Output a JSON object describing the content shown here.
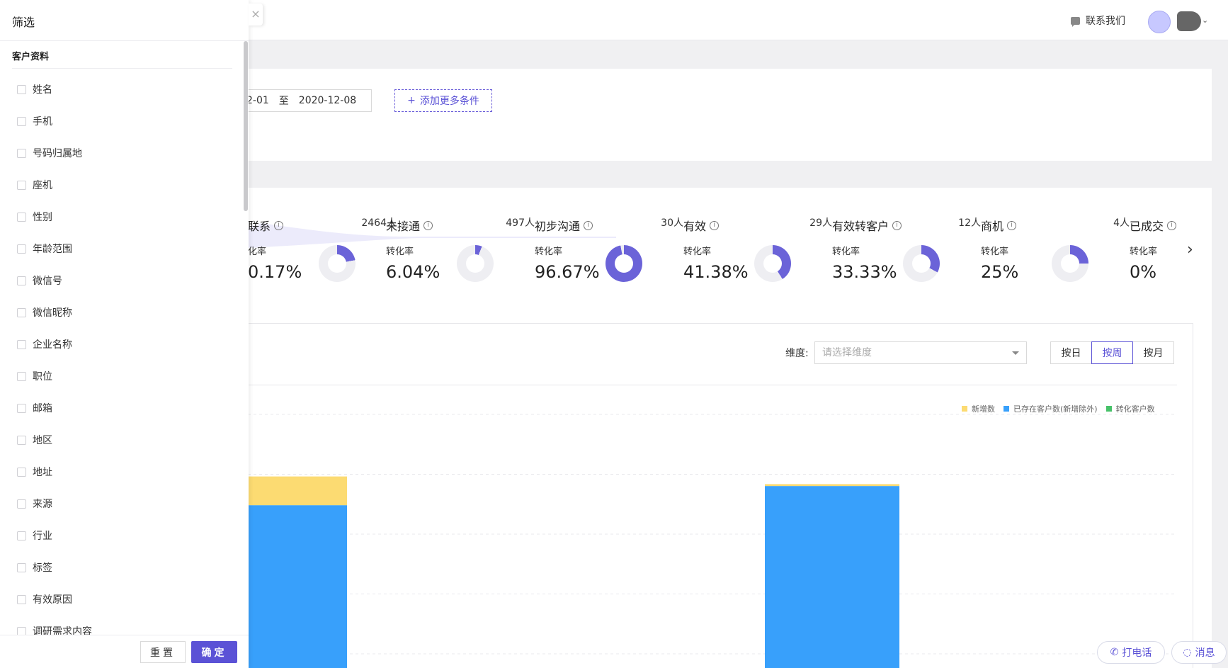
{
  "header": {
    "contact_label": "联系我们",
    "contact_icon": "message-icon",
    "avatar_color": "#c7c8ff"
  },
  "filters": {
    "date_start": "2-01",
    "date_sep": "至",
    "date_end": "2020-12-08",
    "add_condition_label": "添加更多条件",
    "add_condition_icon": "plus-icon"
  },
  "funnel": {
    "stages": [
      {
        "name": "联系",
        "count": "2464人",
        "rate_label": "化率",
        "rate": "0.17%",
        "donut_pct": 22
      },
      {
        "name": "未接通",
        "count": "497人",
        "rate_label": "转化率",
        "rate": "6.04%",
        "donut_pct": 6
      },
      {
        "name": "初步沟通",
        "count": "30人",
        "rate_label": "转化率",
        "rate": "96.67%",
        "donut_pct": 97
      },
      {
        "name": "有效",
        "count": "29人",
        "rate_label": "转化率",
        "rate": "41.38%",
        "donut_pct": 41
      },
      {
        "name": "有效转客户",
        "count": "12人",
        "rate_label": "转化率",
        "rate": "33.33%",
        "donut_pct": 33
      },
      {
        "name": "商机",
        "count": "4人",
        "rate_label": "转化率",
        "rate": "25%",
        "donut_pct": 25
      },
      {
        "name": "已成交",
        "count": "",
        "rate_label": "转化率",
        "rate": "0%",
        "donut_pct": 0
      }
    ],
    "info_glyph": "i",
    "accent": "#6b63d8"
  },
  "chart_controls": {
    "dimension_label": "维度:",
    "dimension_placeholder": "请选择维度",
    "period_buttons": [
      "按日",
      "按周",
      "按月"
    ],
    "active_period": "按周"
  },
  "chart_data": {
    "type": "bar",
    "stacked": true,
    "series": [
      {
        "name": "新增数",
        "color": "#fcdb72",
        "values": [
          3,
          0.2
        ]
      },
      {
        "name": "已存在客户数(新增除外)",
        "color": "#38a0fb",
        "values": [
          17,
          19
        ]
      },
      {
        "name": "转化客户数",
        "color": "#47c269",
        "values": [
          0,
          0
        ]
      }
    ],
    "grid": true,
    "legend_position": "top-right"
  },
  "drawer": {
    "title": "筛选",
    "close_glyph": "×",
    "section_title": "客户资料",
    "fields": [
      "姓名",
      "手机",
      "号码归属地",
      "座机",
      "性别",
      "年龄范围",
      "微信号",
      "微信昵称",
      "企业名称",
      "职位",
      "邮箱",
      "地区",
      "地址",
      "来源",
      "行业",
      "标签",
      "有效原因",
      "调研需求内容"
    ],
    "reset_label": "重置",
    "ok_label": "确定"
  },
  "floating": {
    "call_label": "打电话",
    "message_label": "消息"
  }
}
